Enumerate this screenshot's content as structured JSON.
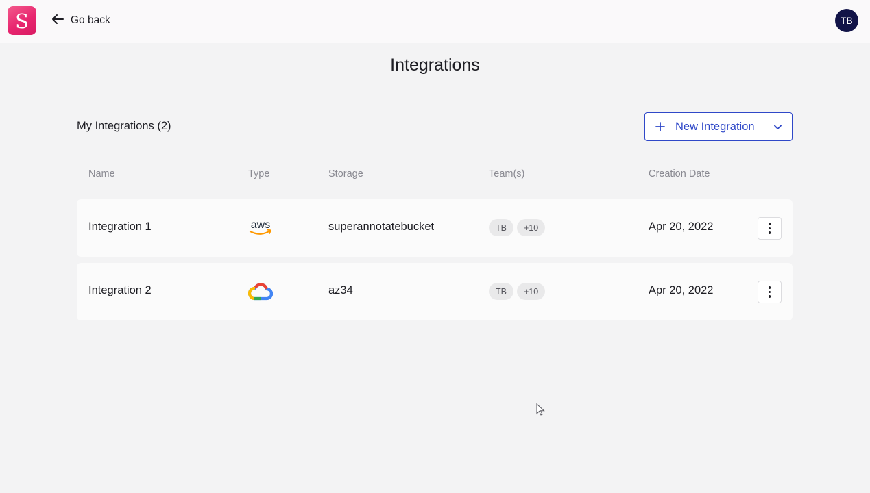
{
  "header": {
    "logo_letter": "S",
    "go_back_label": "Go back",
    "avatar_initials": "TB",
    "icons": {
      "logo": "superannotate-logo",
      "back": "arrow-left-icon"
    }
  },
  "page": {
    "title": "Integrations",
    "section_title": "My Integrations (2)",
    "new_button_label": "New Integration",
    "accent_color": "#2f48c8"
  },
  "table": {
    "columns": [
      "Name",
      "Type",
      "Storage",
      "Team(s)",
      "Creation Date"
    ],
    "rows": [
      {
        "name": "Integration 1",
        "type": "aws-icon",
        "storage": "superannotatebucket",
        "teams": [
          "TB",
          "+10"
        ],
        "creation_date": "Apr 20, 2022"
      },
      {
        "name": "Integration 2",
        "type": "google-cloud-icon",
        "storage": "az34",
        "teams": [
          "TB",
          "+10"
        ],
        "creation_date": "Apr 20, 2022"
      }
    ]
  }
}
